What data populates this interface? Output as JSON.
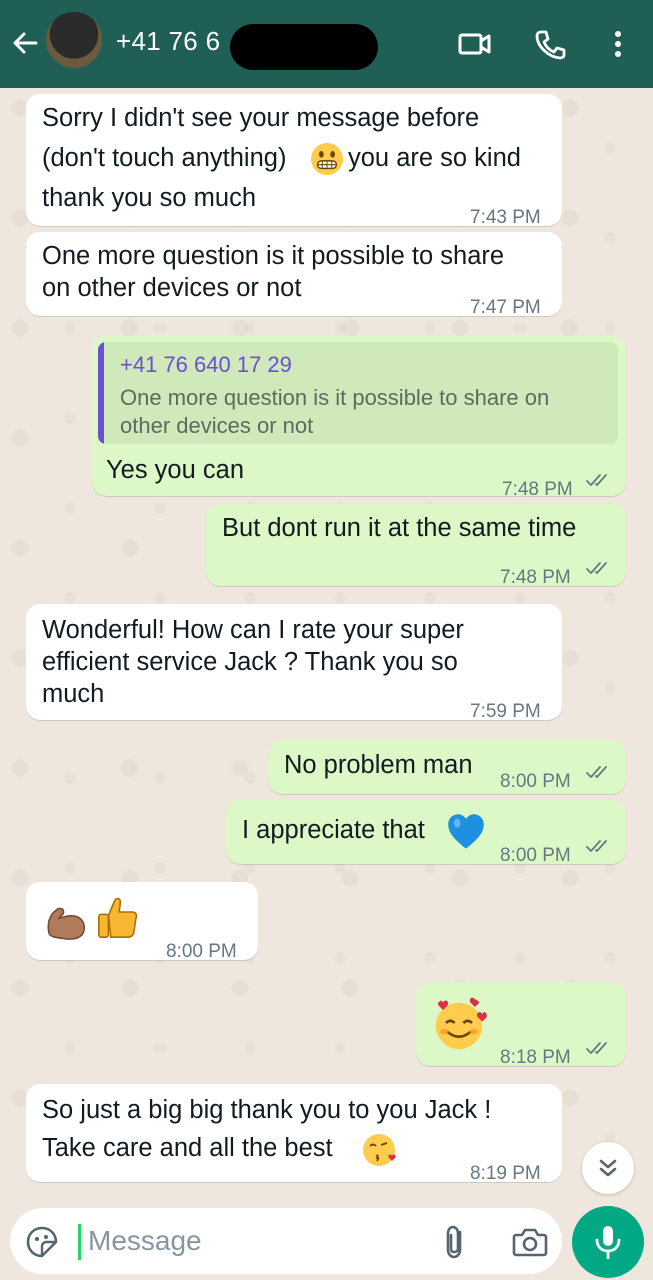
{
  "header": {
    "contact_name": "+41 76 6",
    "icons": [
      "back-arrow-icon",
      "avatar",
      "video-call-icon",
      "voice-call-icon",
      "more-options-icon"
    ]
  },
  "messages": [
    {
      "direction": "in",
      "lines": [
        "Sorry I didn't see your message before",
        "(don't touch anything)",
        "you are so kind",
        "thank you so much"
      ],
      "emoji_after_line2": "grimacing-face",
      "time": "7:43 PM"
    },
    {
      "direction": "in",
      "lines": [
        "One more question is it possible to share",
        "on other devices or not"
      ],
      "time": "7:47 PM"
    },
    {
      "direction": "out",
      "quote": {
        "name": "+41 76 640 17 29",
        "text": "One more question is it possible to share on\nother devices or not"
      },
      "text": "Yes you can",
      "time": "7:48 PM",
      "status": "read"
    },
    {
      "direction": "out",
      "text": "But dont run it at the same time",
      "time": "7:48 PM",
      "status": "read"
    },
    {
      "direction": "in",
      "lines": [
        "Wonderful! How can I rate your super",
        "efficient service Jack ? Thank you so",
        "much"
      ],
      "time": "7:59 PM"
    },
    {
      "direction": "out",
      "text": "No problem man",
      "time": "8:00 PM",
      "status": "read"
    },
    {
      "direction": "out",
      "text": "I appreciate that",
      "emoji": "blue-heart",
      "time": "8:00 PM",
      "status": "read"
    },
    {
      "direction": "in",
      "emoji": [
        "flexed-biceps",
        "thumbs-up"
      ],
      "time": "8:00 PM"
    },
    {
      "direction": "out",
      "emoji": [
        "smiling-face-with-hearts"
      ],
      "time": "8:18 PM",
      "status": "read"
    },
    {
      "direction": "in",
      "lines": [
        "So just a big big thank you to you Jack !",
        "Take care and all the best"
      ],
      "emoji": "face-blowing-a-kiss",
      "time": "8:19 PM"
    }
  ],
  "composer": {
    "placeholder": "Message"
  },
  "colors": {
    "header": "#1f5f56",
    "incoming_bubble": "#ffffff",
    "outgoing_bubble": "#dcf8c6",
    "read_ticks": "#667781",
    "quote_accent": "#6c4fd3",
    "mic_button": "#00a884"
  }
}
